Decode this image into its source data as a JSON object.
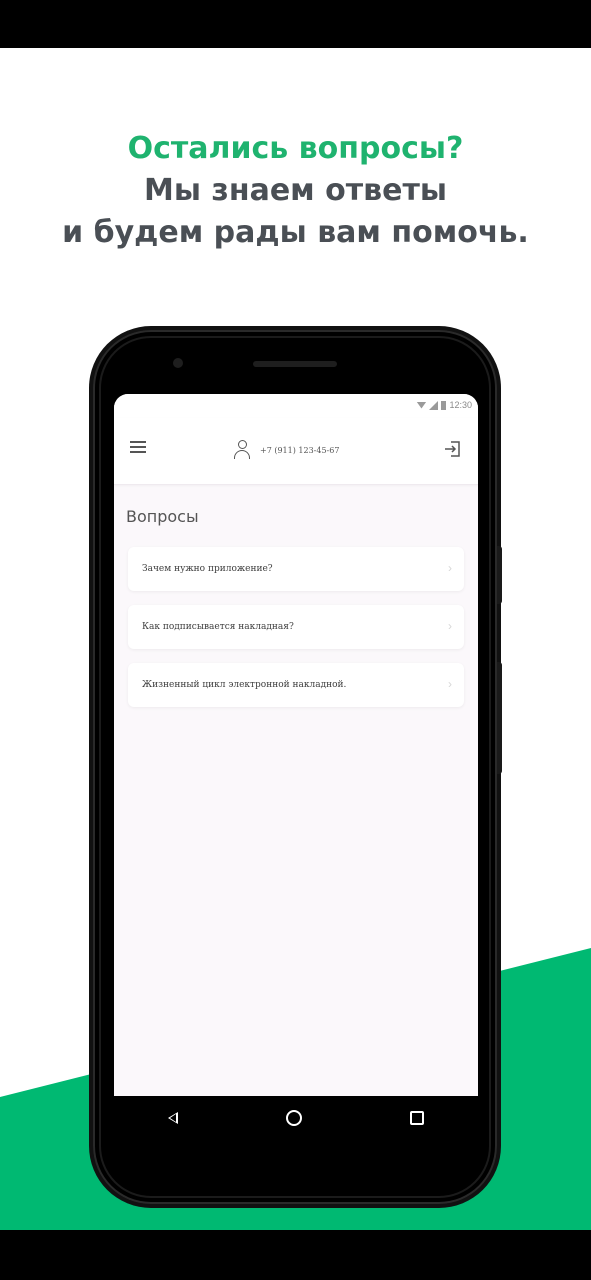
{
  "headline": {
    "line1": "Остались вопросы?",
    "line2": "Мы знаем ответы",
    "line3": "и будем рады вам помочь."
  },
  "colors": {
    "accent_green": "#1fb36f",
    "bg_green": "#00b972",
    "headline_gray": "#4a4f55"
  },
  "device": {
    "status_time": "12:30",
    "app": {
      "phone_number": "+7 (911) 123-45-67",
      "section_title": "Вопросы",
      "questions": [
        {
          "text": "Зачем нужно приложение?"
        },
        {
          "text": "Как подписывается накладная?"
        },
        {
          "text": "Жизненный цикл электронной накладной."
        }
      ]
    },
    "icons": [
      "menu-icon",
      "user-icon",
      "logout-icon",
      "back-icon",
      "home-icon",
      "recents-icon"
    ]
  }
}
